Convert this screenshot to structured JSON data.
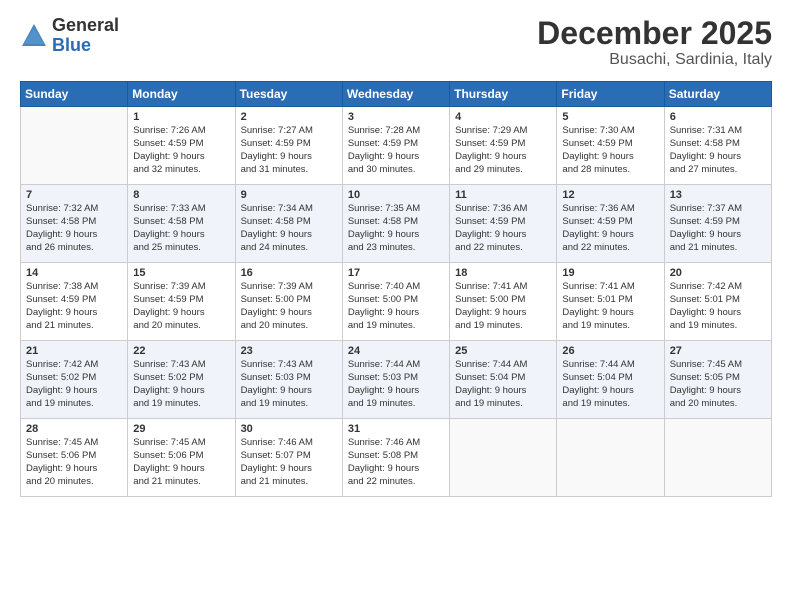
{
  "header": {
    "logo_general": "General",
    "logo_blue": "Blue",
    "month": "December 2025",
    "location": "Busachi, Sardinia, Italy"
  },
  "calendar": {
    "weekdays": [
      "Sunday",
      "Monday",
      "Tuesday",
      "Wednesday",
      "Thursday",
      "Friday",
      "Saturday"
    ],
    "weeks": [
      [
        {
          "day": "",
          "info": ""
        },
        {
          "day": "1",
          "info": "Sunrise: 7:26 AM\nSunset: 4:59 PM\nDaylight: 9 hours\nand 32 minutes."
        },
        {
          "day": "2",
          "info": "Sunrise: 7:27 AM\nSunset: 4:59 PM\nDaylight: 9 hours\nand 31 minutes."
        },
        {
          "day": "3",
          "info": "Sunrise: 7:28 AM\nSunset: 4:59 PM\nDaylight: 9 hours\nand 30 minutes."
        },
        {
          "day": "4",
          "info": "Sunrise: 7:29 AM\nSunset: 4:59 PM\nDaylight: 9 hours\nand 29 minutes."
        },
        {
          "day": "5",
          "info": "Sunrise: 7:30 AM\nSunset: 4:59 PM\nDaylight: 9 hours\nand 28 minutes."
        },
        {
          "day": "6",
          "info": "Sunrise: 7:31 AM\nSunset: 4:58 PM\nDaylight: 9 hours\nand 27 minutes."
        }
      ],
      [
        {
          "day": "7",
          "info": "Sunrise: 7:32 AM\nSunset: 4:58 PM\nDaylight: 9 hours\nand 26 minutes."
        },
        {
          "day": "8",
          "info": "Sunrise: 7:33 AM\nSunset: 4:58 PM\nDaylight: 9 hours\nand 25 minutes."
        },
        {
          "day": "9",
          "info": "Sunrise: 7:34 AM\nSunset: 4:58 PM\nDaylight: 9 hours\nand 24 minutes."
        },
        {
          "day": "10",
          "info": "Sunrise: 7:35 AM\nSunset: 4:58 PM\nDaylight: 9 hours\nand 23 minutes."
        },
        {
          "day": "11",
          "info": "Sunrise: 7:36 AM\nSunset: 4:59 PM\nDaylight: 9 hours\nand 22 minutes."
        },
        {
          "day": "12",
          "info": "Sunrise: 7:36 AM\nSunset: 4:59 PM\nDaylight: 9 hours\nand 22 minutes."
        },
        {
          "day": "13",
          "info": "Sunrise: 7:37 AM\nSunset: 4:59 PM\nDaylight: 9 hours\nand 21 minutes."
        }
      ],
      [
        {
          "day": "14",
          "info": "Sunrise: 7:38 AM\nSunset: 4:59 PM\nDaylight: 9 hours\nand 21 minutes."
        },
        {
          "day": "15",
          "info": "Sunrise: 7:39 AM\nSunset: 4:59 PM\nDaylight: 9 hours\nand 20 minutes."
        },
        {
          "day": "16",
          "info": "Sunrise: 7:39 AM\nSunset: 5:00 PM\nDaylight: 9 hours\nand 20 minutes."
        },
        {
          "day": "17",
          "info": "Sunrise: 7:40 AM\nSunset: 5:00 PM\nDaylight: 9 hours\nand 19 minutes."
        },
        {
          "day": "18",
          "info": "Sunrise: 7:41 AM\nSunset: 5:00 PM\nDaylight: 9 hours\nand 19 minutes."
        },
        {
          "day": "19",
          "info": "Sunrise: 7:41 AM\nSunset: 5:01 PM\nDaylight: 9 hours\nand 19 minutes."
        },
        {
          "day": "20",
          "info": "Sunrise: 7:42 AM\nSunset: 5:01 PM\nDaylight: 9 hours\nand 19 minutes."
        }
      ],
      [
        {
          "day": "21",
          "info": "Sunrise: 7:42 AM\nSunset: 5:02 PM\nDaylight: 9 hours\nand 19 minutes."
        },
        {
          "day": "22",
          "info": "Sunrise: 7:43 AM\nSunset: 5:02 PM\nDaylight: 9 hours\nand 19 minutes."
        },
        {
          "day": "23",
          "info": "Sunrise: 7:43 AM\nSunset: 5:03 PM\nDaylight: 9 hours\nand 19 minutes."
        },
        {
          "day": "24",
          "info": "Sunrise: 7:44 AM\nSunset: 5:03 PM\nDaylight: 9 hours\nand 19 minutes."
        },
        {
          "day": "25",
          "info": "Sunrise: 7:44 AM\nSunset: 5:04 PM\nDaylight: 9 hours\nand 19 minutes."
        },
        {
          "day": "26",
          "info": "Sunrise: 7:44 AM\nSunset: 5:04 PM\nDaylight: 9 hours\nand 19 minutes."
        },
        {
          "day": "27",
          "info": "Sunrise: 7:45 AM\nSunset: 5:05 PM\nDaylight: 9 hours\nand 20 minutes."
        }
      ],
      [
        {
          "day": "28",
          "info": "Sunrise: 7:45 AM\nSunset: 5:06 PM\nDaylight: 9 hours\nand 20 minutes."
        },
        {
          "day": "29",
          "info": "Sunrise: 7:45 AM\nSunset: 5:06 PM\nDaylight: 9 hours\nand 21 minutes."
        },
        {
          "day": "30",
          "info": "Sunrise: 7:46 AM\nSunset: 5:07 PM\nDaylight: 9 hours\nand 21 minutes."
        },
        {
          "day": "31",
          "info": "Sunrise: 7:46 AM\nSunset: 5:08 PM\nDaylight: 9 hours\nand 22 minutes."
        },
        {
          "day": "",
          "info": ""
        },
        {
          "day": "",
          "info": ""
        },
        {
          "day": "",
          "info": ""
        }
      ]
    ]
  }
}
